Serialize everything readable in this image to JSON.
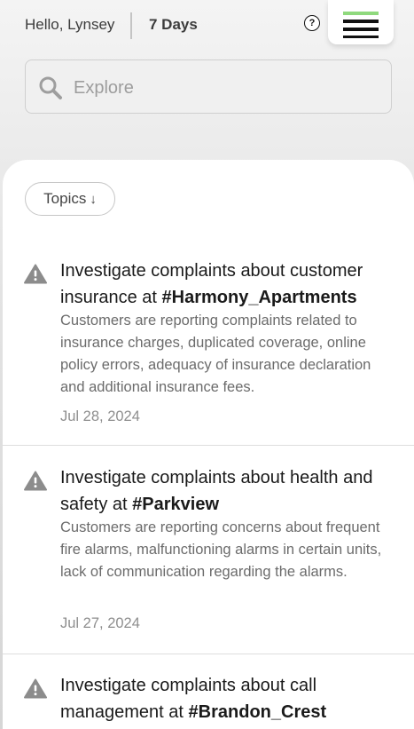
{
  "header": {
    "greeting": "Hello, Lynsey",
    "period": "7 Days",
    "help_label": "?",
    "menu_icon": "hamburger-menu-icon",
    "menu_accent_color": "#8fd97d"
  },
  "search": {
    "placeholder": "Explore",
    "value": "",
    "icon": "search-icon"
  },
  "filter": {
    "label": "Topics",
    "arrow": "↓"
  },
  "feed": {
    "items": [
      {
        "title": "Investigate complaints about customer insurance at ",
        "tag": "#Harmony_Apartments",
        "description": "Customers are reporting complaints related to insurance charges, duplicated coverage, online policy errors, adequacy of insurance declaration and additional insurance fees.",
        "date": "Jul 28, 2024",
        "icon": "warning-icon"
      },
      {
        "title": "Investigate complaints about health and safety at ",
        "tag": "#Parkview",
        "description": "Customers are reporting concerns about frequent fire alarms, malfunctioning alarms in certain units, lack of communication regarding the alarms.",
        "date": "Jul 27, 2024",
        "icon": "warning-icon"
      },
      {
        "title": "Investigate complaints about call management at ",
        "tag": "#Brandon_Crest",
        "description": "",
        "date": "",
        "icon": "warning-icon"
      }
    ]
  }
}
